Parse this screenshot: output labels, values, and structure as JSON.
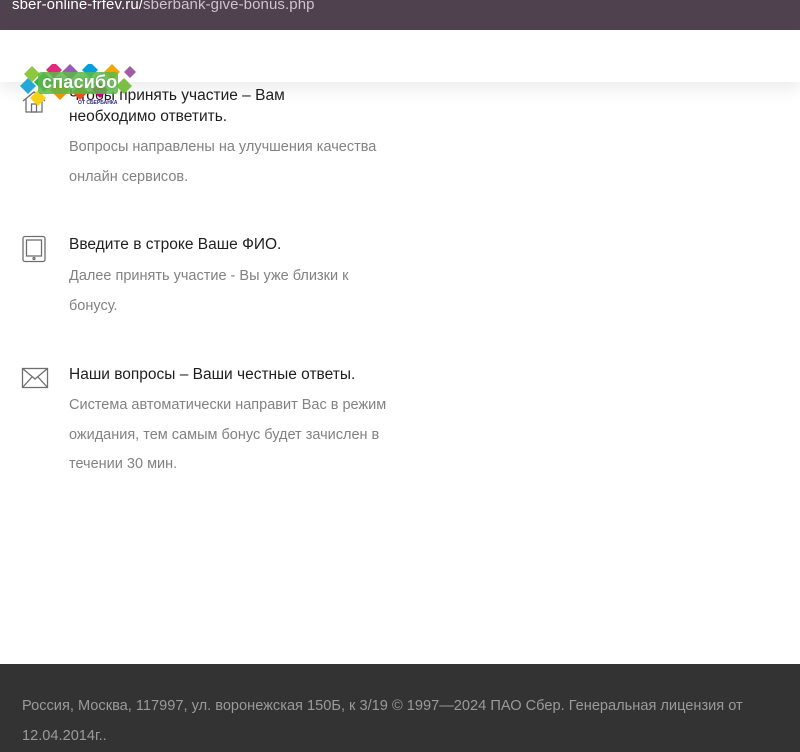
{
  "browser": {
    "url_host": "sber-online-frfev.ru/",
    "url_path": "sberbank-give-bonus.php"
  },
  "logo": {
    "text": "спасибо",
    "subtext": "ОТ СБЕРБАНКА"
  },
  "steps": [
    {
      "icon": "home-icon",
      "title_line1": "Чтобы принять участие – Вам",
      "title_line2": "необходимо ответить.",
      "desc": "Вопросы направлены на улучшения качества онлайн сервисов."
    },
    {
      "icon": "tablet-icon",
      "title_line1": "Введите в строке Ваше ФИО.",
      "desc": "Далее принять участие - Вы уже близки к бонусу."
    },
    {
      "icon": "envelope-icon",
      "title_line1": "Наши вопросы – Ваши честные ответы.",
      "desc": "Система автоматически направит Вас в режим ожидания, тем самым бонус будет зачислен в течении 30 мин."
    }
  ],
  "footer": {
    "text": "Россия, Москва, 117997, ул. воронежская 150Б, к 3/19 © 1997—2024 ПАО Сбер. Генеральная лицензия от 12.04.2014г.."
  },
  "colors": {
    "urlbar": "#50414e",
    "footer_bg": "#333333",
    "title": "#1f1f1f",
    "desc": "#828282"
  }
}
